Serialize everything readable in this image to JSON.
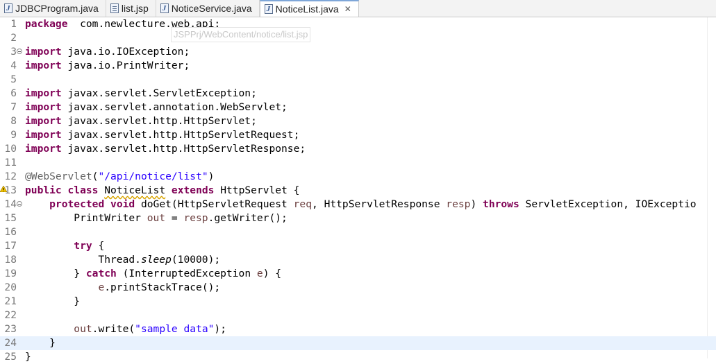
{
  "tabs": [
    {
      "label": "JDBCProgram.java",
      "icon": "java-file-icon",
      "active": false
    },
    {
      "label": "list.jsp",
      "icon": "jsp-file-icon",
      "active": false
    },
    {
      "label": "NoticeService.java",
      "icon": "java-file-icon",
      "active": false
    },
    {
      "label": "NoticeList.java",
      "icon": "java-file-icon",
      "active": true
    }
  ],
  "close_glyph": "✕",
  "tooltip": "JSPPrj/WebContent/notice/list.jsp",
  "editor": {
    "current_line": 24,
    "lines": [
      {
        "n": "1",
        "tokens": [
          [
            "kw",
            "package"
          ],
          [
            "",
            "  com.newlecture.web.api;"
          ]
        ]
      },
      {
        "n": "2",
        "tokens": []
      },
      {
        "n": "3",
        "fold": true,
        "tokens": [
          [
            "kw",
            "import"
          ],
          [
            "",
            " java.io.IOException;"
          ]
        ]
      },
      {
        "n": "4",
        "tokens": [
          [
            "kw",
            "import"
          ],
          [
            "",
            " java.io.PrintWriter;"
          ]
        ]
      },
      {
        "n": "5",
        "tokens": []
      },
      {
        "n": "6",
        "tokens": [
          [
            "kw",
            "import"
          ],
          [
            "",
            " javax.servlet.ServletException;"
          ]
        ]
      },
      {
        "n": "7",
        "tokens": [
          [
            "kw",
            "import"
          ],
          [
            "",
            " javax.servlet.annotation.WebServlet;"
          ]
        ]
      },
      {
        "n": "8",
        "tokens": [
          [
            "kw",
            "import"
          ],
          [
            "",
            " javax.servlet.http.HttpServlet;"
          ]
        ]
      },
      {
        "n": "9",
        "tokens": [
          [
            "kw",
            "import"
          ],
          [
            "",
            " javax.servlet.http.HttpServletRequest;"
          ]
        ]
      },
      {
        "n": "10",
        "tokens": [
          [
            "kw",
            "import"
          ],
          [
            "",
            " javax.servlet.http.HttpServletResponse;"
          ]
        ]
      },
      {
        "n": "11",
        "tokens": []
      },
      {
        "n": "12",
        "tokens": [
          [
            "ann",
            "@WebServlet"
          ],
          [
            "",
            "("
          ],
          [
            "str",
            "\"/api/notice/list\""
          ],
          [
            "",
            ")"
          ]
        ]
      },
      {
        "n": "13",
        "warn": true,
        "tokens": [
          [
            "kw",
            "public"
          ],
          [
            "",
            " "
          ],
          [
            "kw",
            "class"
          ],
          [
            "",
            " "
          ],
          [
            "warnline",
            "NoticeList"
          ],
          [
            "",
            " "
          ],
          [
            "kw",
            "extends"
          ],
          [
            "",
            " HttpServlet {"
          ]
        ]
      },
      {
        "n": "14",
        "fold": true,
        "tokens": [
          [
            "",
            "    "
          ],
          [
            "kw",
            "protected"
          ],
          [
            "",
            " "
          ],
          [
            "kw",
            "void"
          ],
          [
            "",
            " doGet(HttpServletRequest "
          ],
          [
            "param",
            "req"
          ],
          [
            "",
            ", HttpServletResponse "
          ],
          [
            "param",
            "resp"
          ],
          [
            "",
            ") "
          ],
          [
            "kw",
            "throws"
          ],
          [
            "",
            " ServletException, IOExceptio"
          ]
        ]
      },
      {
        "n": "15",
        "tokens": [
          [
            "",
            "        PrintWriter "
          ],
          [
            "param",
            "out"
          ],
          [
            "",
            " = "
          ],
          [
            "param",
            "resp"
          ],
          [
            "",
            ".getWriter();"
          ]
        ]
      },
      {
        "n": "16",
        "tokens": []
      },
      {
        "n": "17",
        "tokens": [
          [
            "",
            "        "
          ],
          [
            "kw",
            "try"
          ],
          [
            "",
            " {"
          ]
        ]
      },
      {
        "n": "18",
        "tokens": [
          [
            "",
            "            Thread."
          ],
          [
            "static",
            "sleep"
          ],
          [
            "",
            "(10000);"
          ]
        ]
      },
      {
        "n": "19",
        "tokens": [
          [
            "",
            "        } "
          ],
          [
            "kw",
            "catch"
          ],
          [
            "",
            " (InterruptedException "
          ],
          [
            "param",
            "e"
          ],
          [
            "",
            ") {"
          ]
        ]
      },
      {
        "n": "20",
        "tokens": [
          [
            "",
            "            "
          ],
          [
            "param",
            "e"
          ],
          [
            "",
            ".printStackTrace();"
          ]
        ]
      },
      {
        "n": "21",
        "tokens": [
          [
            "",
            "        }"
          ]
        ]
      },
      {
        "n": "22",
        "tokens": []
      },
      {
        "n": "23",
        "tokens": [
          [
            "",
            "        "
          ],
          [
            "param",
            "out"
          ],
          [
            "",
            ".write("
          ],
          [
            "str",
            "\"sample data\""
          ],
          [
            "",
            ");"
          ]
        ]
      },
      {
        "n": "24",
        "tokens": [
          [
            "",
            "    }"
          ]
        ]
      },
      {
        "n": "25",
        "tokens": [
          [
            "",
            "}"
          ]
        ]
      }
    ]
  }
}
